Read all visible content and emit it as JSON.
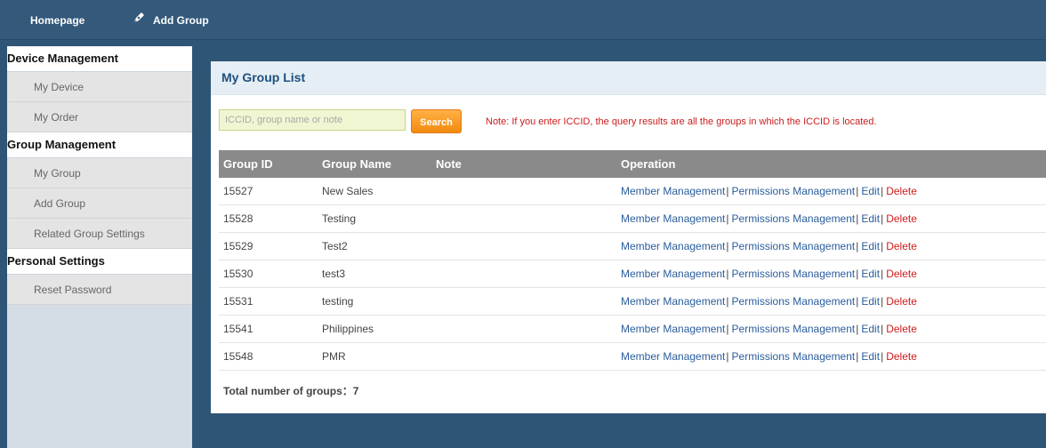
{
  "topnav": {
    "home_label": "Homepage",
    "add_group_label": "Add Group"
  },
  "sidebar": {
    "sections": [
      {
        "title": "Device Management",
        "items": [
          "My Device",
          "My Order"
        ]
      },
      {
        "title": "Group Management",
        "items": [
          "My Group",
          "Add Group",
          "Related Group Settings"
        ]
      },
      {
        "title": "Personal Settings",
        "items": [
          "Reset Password"
        ]
      }
    ]
  },
  "panel": {
    "title": "My Group List",
    "search": {
      "placeholder": "ICCID, group name or note",
      "value": "",
      "button_label": "Search"
    },
    "note": "Note: If you enter ICCID, the query results are all the groups in which the ICCID is located.",
    "table": {
      "columns": [
        "Group ID",
        "Group Name",
        "Note",
        "Operation"
      ],
      "operations": [
        "Member Management",
        "Permissions Management",
        "Edit",
        "Delete"
      ],
      "rows": [
        {
          "id": "15527",
          "name": "New Sales",
          "note": ""
        },
        {
          "id": "15528",
          "name": "Testing",
          "note": ""
        },
        {
          "id": "15529",
          "name": "Test2",
          "note": ""
        },
        {
          "id": "15530",
          "name": "test3",
          "note": ""
        },
        {
          "id": "15531",
          "name": "testing",
          "note": ""
        },
        {
          "id": "15541",
          "name": "Philippines",
          "note": ""
        },
        {
          "id": "15548",
          "name": "PMR",
          "note": ""
        }
      ]
    },
    "total_label": "Total number of groups：7"
  },
  "colors": {
    "background": "#2f5576",
    "accent_button": "#f28a0f",
    "note_text": "#cc1b1b",
    "link": "#2a5d9c",
    "delete_link": "#d11b1b",
    "table_header": "#8a8a8a"
  }
}
